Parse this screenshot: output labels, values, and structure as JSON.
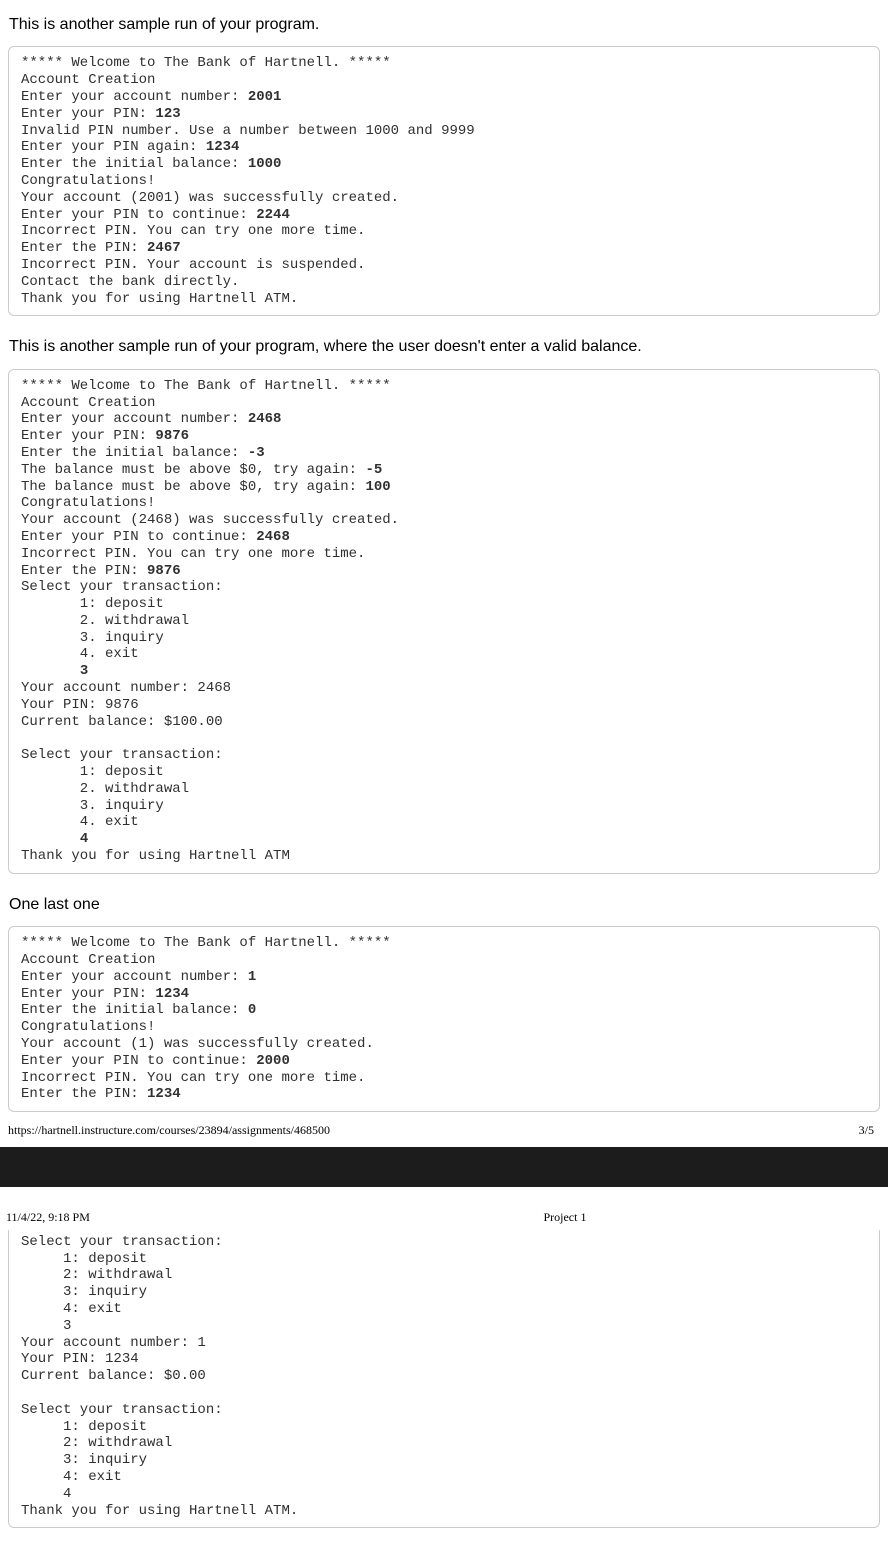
{
  "headings": {
    "h1": "This is another sample run of your program.",
    "h2": "This is another sample run of your program, where the user doesn't enter a valid balance.",
    "h3": "One last one"
  },
  "sample1": {
    "parts": [
      {
        "t": "***** Welcome to The Bank of Hartnell. *****\nAccount Creation\nEnter your account number: ",
        "b": false
      },
      {
        "t": "2001",
        "b": true
      },
      {
        "t": "\nEnter your PIN: ",
        "b": false
      },
      {
        "t": "123",
        "b": true
      },
      {
        "t": "\nInvalid PIN number. Use a number between 1000 and 9999\nEnter your PIN again: ",
        "b": false
      },
      {
        "t": "1234",
        "b": true
      },
      {
        "t": "\nEnter the initial balance: ",
        "b": false
      },
      {
        "t": "1000",
        "b": true
      },
      {
        "t": "\nCongratulations!\nYour account (2001) was successfully created.\nEnter your PIN to continue: ",
        "b": false
      },
      {
        "t": "2244",
        "b": true
      },
      {
        "t": "\nIncorrect PIN. You can try one more time.\nEnter the PIN: ",
        "b": false
      },
      {
        "t": "2467",
        "b": true
      },
      {
        "t": "\nIncorrect PIN. Your account is suspended.\nContact the bank directly.\nThank you for using Hartnell ATM.",
        "b": false
      }
    ]
  },
  "sample2": {
    "parts": [
      {
        "t": "***** Welcome to The Bank of Hartnell. *****\nAccount Creation\nEnter your account number: ",
        "b": false
      },
      {
        "t": "2468",
        "b": true
      },
      {
        "t": "\nEnter your PIN: ",
        "b": false
      },
      {
        "t": "9876",
        "b": true
      },
      {
        "t": "\nEnter the initial balance: ",
        "b": false
      },
      {
        "t": "-3",
        "b": true
      },
      {
        "t": "\nThe balance must be above $0, try again: ",
        "b": false
      },
      {
        "t": "-5",
        "b": true
      },
      {
        "t": "\nThe balance must be above $0, try again: ",
        "b": false
      },
      {
        "t": "100",
        "b": true
      },
      {
        "t": "\nCongratulations!\nYour account (2468) was successfully created.\nEnter your PIN to continue: ",
        "b": false
      },
      {
        "t": "2468",
        "b": true
      },
      {
        "t": "\nIncorrect PIN. You can try one more time.\nEnter the PIN: ",
        "b": false
      },
      {
        "t": "9876",
        "b": true
      },
      {
        "t": "\nSelect your transaction:\n       1: deposit\n       2. withdrawal\n       3. inquiry\n       4. exit\n       ",
        "b": false
      },
      {
        "t": "3",
        "b": true
      },
      {
        "t": "\nYour account number: 2468\nYour PIN: 9876\nCurrent balance: $100.00\n\nSelect your transaction:\n       1: deposit\n       2. withdrawal\n       3. inquiry\n       4. exit\n       ",
        "b": false
      },
      {
        "t": "4",
        "b": true
      },
      {
        "t": "\nThank you for using Hartnell ATM",
        "b": false
      }
    ]
  },
  "sample3a": {
    "parts": [
      {
        "t": "***** Welcome to The Bank of Hartnell. *****\nAccount Creation\nEnter your account number: ",
        "b": false
      },
      {
        "t": "1",
        "b": true
      },
      {
        "t": "\nEnter your PIN: ",
        "b": false
      },
      {
        "t": "1234",
        "b": true
      },
      {
        "t": "\nEnter the initial balance: ",
        "b": false
      },
      {
        "t": "0",
        "b": true
      },
      {
        "t": "\nCongratulations!\nYour account (1) was successfully created.\nEnter your PIN to continue: ",
        "b": false
      },
      {
        "t": "2000",
        "b": true
      },
      {
        "t": "\nIncorrect PIN. You can try one more time.\nEnter the PIN: ",
        "b": false
      },
      {
        "t": "1234",
        "b": true
      }
    ]
  },
  "sample3b": {
    "parts": [
      {
        "t": "Select your transaction:\n     1: deposit\n     2: withdrawal\n     3: inquiry\n     4: exit\n     ",
        "b": false
      },
      {
        "t": "3",
        "b": true
      },
      {
        "t": "\nYour account number: 1\nYour PIN: 1234\nCurrent balance: $0.00\n\nSelect your transaction:\n     1: deposit\n     2: withdrawal\n     3: inquiry\n     4: exit\n     ",
        "b": false
      },
      {
        "t": "4",
        "b": true
      },
      {
        "t": "\nThank you for using Hartnell ATM.",
        "b": false
      }
    ]
  },
  "footer3": {
    "url": "https://hartnell.instructure.com/courses/23894/assignments/468500",
    "page": "3/5"
  },
  "header4": {
    "datetime": "11/4/22, 9:18 PM",
    "title": "Project 1"
  }
}
